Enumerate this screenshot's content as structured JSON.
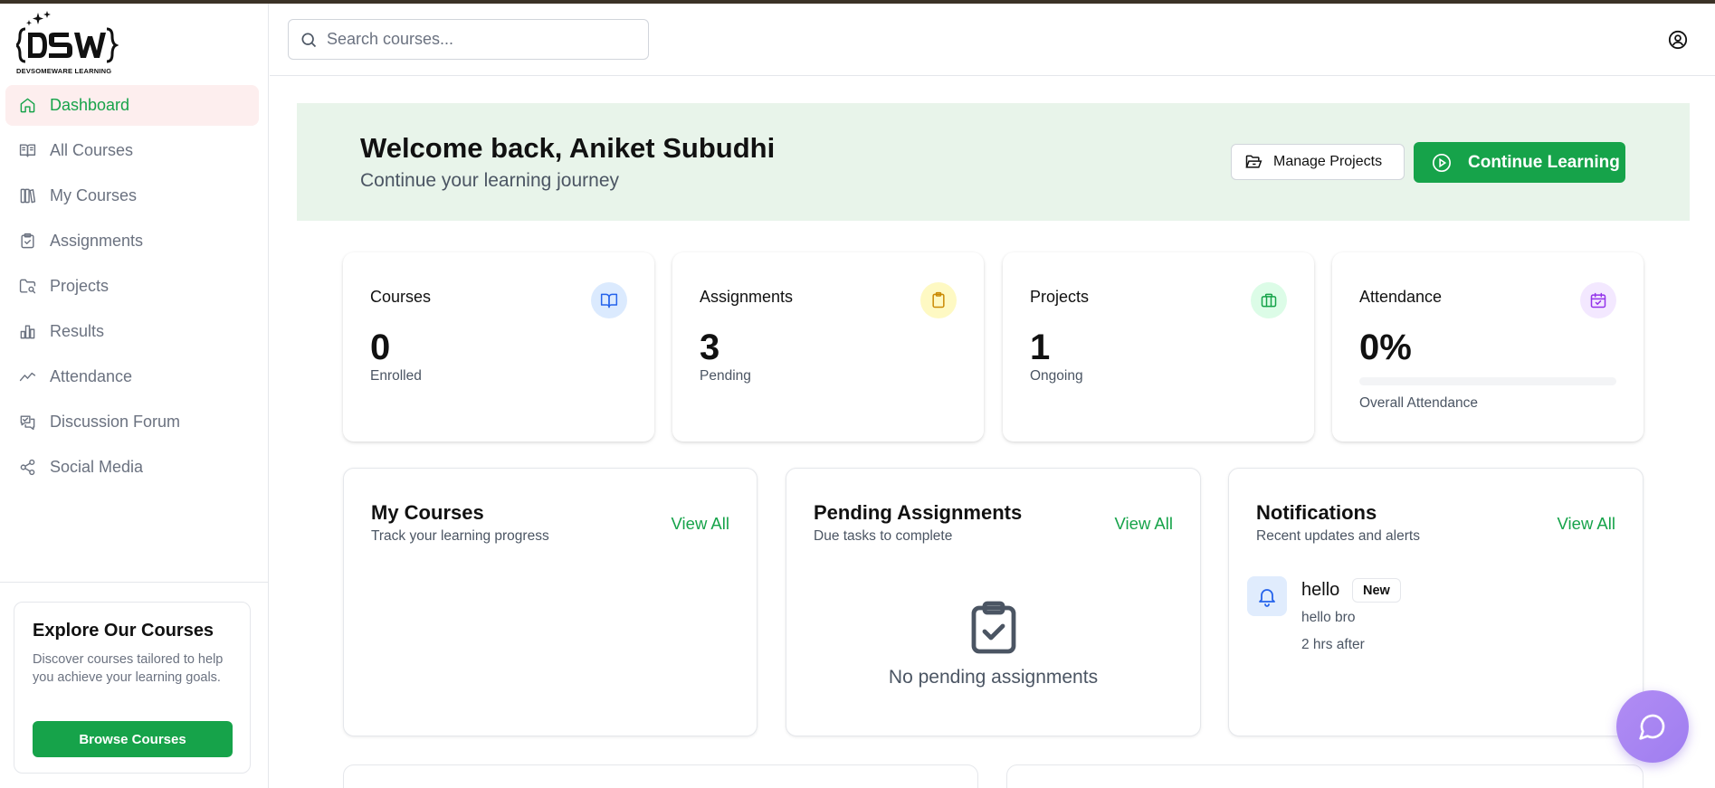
{
  "brand": {
    "logo_text": "DEVSOMEWARE LEARNING"
  },
  "search": {
    "placeholder": "Search courses..."
  },
  "sidebar": {
    "items": [
      {
        "label": "Dashboard",
        "icon": "home-icon",
        "active": true
      },
      {
        "label": "All Courses",
        "icon": "book-open-icon"
      },
      {
        "label": "My Courses",
        "icon": "library-icon"
      },
      {
        "label": "Assignments",
        "icon": "clipboard-check-icon"
      },
      {
        "label": "Projects",
        "icon": "folder-search-icon"
      },
      {
        "label": "Results",
        "icon": "bar-chart-icon"
      },
      {
        "label": "Attendance",
        "icon": "trend-line-icon"
      },
      {
        "label": "Discussion Forum",
        "icon": "message-check-icon"
      },
      {
        "label": "Social Media",
        "icon": "share-icon"
      }
    ],
    "explore": {
      "title": "Explore Our Courses",
      "text": "Discover courses tailored to help you achieve your learning goals.",
      "button": "Browse Courses"
    }
  },
  "welcome": {
    "title": "Welcome back, Aniket Subudhi",
    "subtitle": "Continue your learning journey",
    "manage_projects": "Manage Projects",
    "continue_learning": "Continue Learning"
  },
  "stats": {
    "courses": {
      "title": "Courses",
      "value": "0",
      "label": "Enrolled",
      "icon": "book-icon",
      "icon_bg": "#dbeafe",
      "icon_color": "#2563eb"
    },
    "assignments": {
      "title": "Assignments",
      "value": "3",
      "label": "Pending",
      "icon": "clipboard-icon",
      "icon_bg": "#fef9c3",
      "icon_color": "#ca8a04"
    },
    "projects": {
      "title": "Projects",
      "value": "1",
      "label": "Ongoing",
      "icon": "briefcase-icon",
      "icon_bg": "#dcfce7",
      "icon_color": "#16a34a"
    },
    "attendance": {
      "title": "Attendance",
      "value": "0%",
      "label": "Overall Attendance",
      "progress": 0,
      "icon": "calendar-check-icon",
      "icon_bg": "#f3e8ff",
      "icon_color": "#9333ea"
    }
  },
  "panels": {
    "my_courses": {
      "title": "My Courses",
      "subtitle": "Track your learning progress",
      "view_all": "View All"
    },
    "pending_assignments": {
      "title": "Pending Assignments",
      "subtitle": "Due tasks to complete",
      "view_all": "View All",
      "empty_text": "No pending assignments"
    },
    "notifications": {
      "title": "Notifications",
      "subtitle": "Recent updates and alerts",
      "view_all": "View All",
      "items": [
        {
          "title": "hello",
          "badge": "New",
          "body": "hello bro",
          "time": "2 hrs after"
        }
      ]
    }
  },
  "colors": {
    "accent": "#16a34a",
    "active_bg": "#fdeeee",
    "banner_bg": "#e8f4ea",
    "chat_fab": "#a78bfa"
  }
}
